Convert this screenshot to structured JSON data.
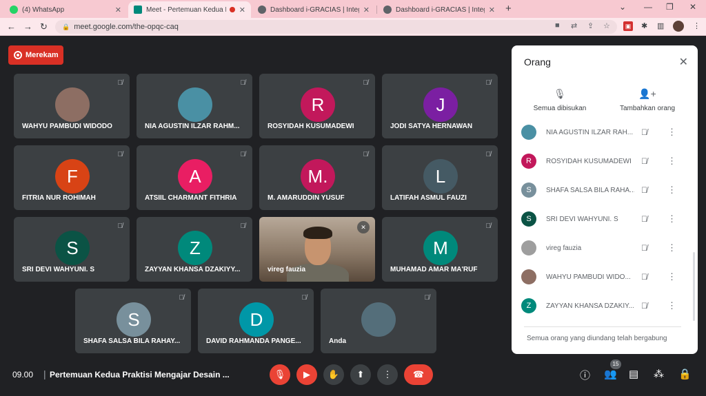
{
  "browser": {
    "tabs": [
      {
        "title": "(4) WhatsApp",
        "favicon_color": "#25d366"
      },
      {
        "title": "Meet - Pertemuan Kedua P",
        "favicon_color": "#00897b",
        "recording": true
      },
      {
        "title": "Dashboard i-GRACIAS | Integrate",
        "favicon_color": "#5f6368"
      },
      {
        "title": "Dashboard i-GRACIAS | Integrate",
        "favicon_color": "#5f6368"
      }
    ],
    "url": "meet.google.com/the-opqc-caq"
  },
  "recording_label": "Merekam",
  "tiles": [
    {
      "name": "WAHYU PAMBUDI WIDODO",
      "initial": "",
      "color": "#8d6e63"
    },
    {
      "name": "NIA AGUSTIN ILZAR RAHM...",
      "initial": "",
      "color": "#4a90a4"
    },
    {
      "name": "ROSYIDAH KUSUMADEWI",
      "initial": "R",
      "color": "#c2185b"
    },
    {
      "name": "JODI SATYA HERNAWAN",
      "initial": "J",
      "color": "#7b1fa2"
    },
    {
      "name": "FITRIA NUR ROHIMAH",
      "initial": "F",
      "color": "#d84315"
    },
    {
      "name": "ATSIIL CHARMANT FITHRIA",
      "initial": "A",
      "color": "#e91e63"
    },
    {
      "name": "M. AMARUDDIN YUSUF",
      "initial": "M.",
      "color": "#c2185b"
    },
    {
      "name": "LATIFAH ASMUL FAUZI",
      "initial": "L",
      "color": "#455a64"
    },
    {
      "name": "SRI DEVI WAHYUNI. S",
      "initial": "S",
      "color": "#0b5345"
    },
    {
      "name": "ZAYYAN KHANSA DZAKIYY...",
      "initial": "Z",
      "color": "#00897b"
    },
    {
      "name": "vireg fauzia",
      "initial": "",
      "color": "#8c7a68"
    },
    {
      "name": "MUHAMAD AMAR MA'RUF",
      "initial": "M",
      "color": "#00897b"
    },
    {
      "name": "SHAFA SALSA BILA RAHAY...",
      "initial": "S",
      "color": "#78909c"
    },
    {
      "name": "DAVID RAHMANDA PANGE...",
      "initial": "D",
      "color": "#0097a7"
    },
    {
      "name": "Anda",
      "initial": "",
      "color": "#3c4043"
    }
  ],
  "bottom_bar": {
    "time": "09.00",
    "meeting_title": "Pertemuan Kedua Praktisi Mengajar Desain ...",
    "participant_count": "15"
  },
  "panel": {
    "title": "Orang",
    "mute_all_label": "Semua dibisukan",
    "add_people_label": "Tambahkan orang",
    "participants": [
      {
        "name": "NIA AGUSTIN ILZAR RAH...",
        "initial": "",
        "color": "#4a90a4"
      },
      {
        "name": "ROSYIDAH KUSUMADEWI",
        "initial": "R",
        "color": "#c2185b"
      },
      {
        "name": "SHAFA SALSA BILA RAHA...",
        "initial": "S",
        "color": "#78909c"
      },
      {
        "name": "SRI DEVI WAHYUNI. S",
        "initial": "S",
        "color": "#0b5345"
      },
      {
        "name": "vireg fauzia",
        "initial": "",
        "color": "#9e9e9e"
      },
      {
        "name": "WAHYU PAMBUDI WIDO...",
        "initial": "",
        "color": "#8d6e63"
      },
      {
        "name": "ZAYYAN KHANSA DZAKIY...",
        "initial": "Z",
        "color": "#00897b"
      }
    ],
    "footer": "Semua orang yang diundang telah bergabung"
  }
}
